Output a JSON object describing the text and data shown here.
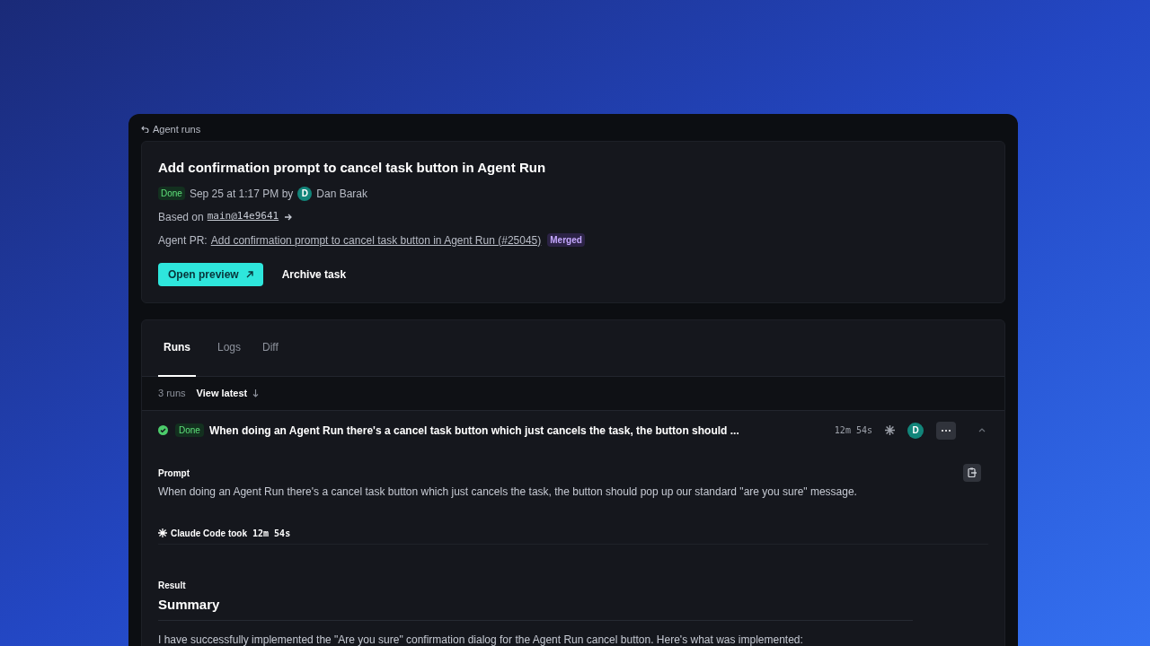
{
  "breadcrumb": {
    "label": "Agent runs"
  },
  "task": {
    "title": "Add confirmation prompt to cancel task button in Agent Run",
    "status": "Done",
    "date": "Sep 25 at 1:17 PM by",
    "author": {
      "initial": "D",
      "name": "Dan Barak"
    },
    "based_on_label": "Based on",
    "commit": "main@14e9641",
    "pr_label": "Agent PR:",
    "pr_link": "Add confirmation prompt to cancel task button in Agent Run (#25045)",
    "pr_badge": "Merged",
    "buttons": [
      {
        "label": "Open preview",
        "kind": "primary"
      },
      {
        "label": "Archive task",
        "kind": "plain"
      }
    ]
  },
  "tabs": [
    {
      "label": "Runs",
      "selected": true
    },
    {
      "label": "Logs",
      "selected": false
    },
    {
      "label": "Diff",
      "selected": false
    }
  ],
  "runs_bar": {
    "count": "3 runs",
    "view_latest": "View latest"
  },
  "run": {
    "status": "Done",
    "title": "When doing an Agent Run there's a cancel task button which just cancels the task, the button should ...",
    "duration": "12m 54s",
    "avatar": "D",
    "expanded": true,
    "prompt_label": "Prompt",
    "prompt": "When doing an Agent Run there's a cancel task button which just cancels the task, the button should pop up our standard \"are you sure\" message.",
    "agent_label": "Claude Code took",
    "agent_time": "12m 54s",
    "result_label": "Result",
    "result_heading": "Summary",
    "result_text": "I have successfully implemented the \"Are you sure\" confirmation dialog for the Agent Run cancel button. Here's what was implemented:"
  }
}
